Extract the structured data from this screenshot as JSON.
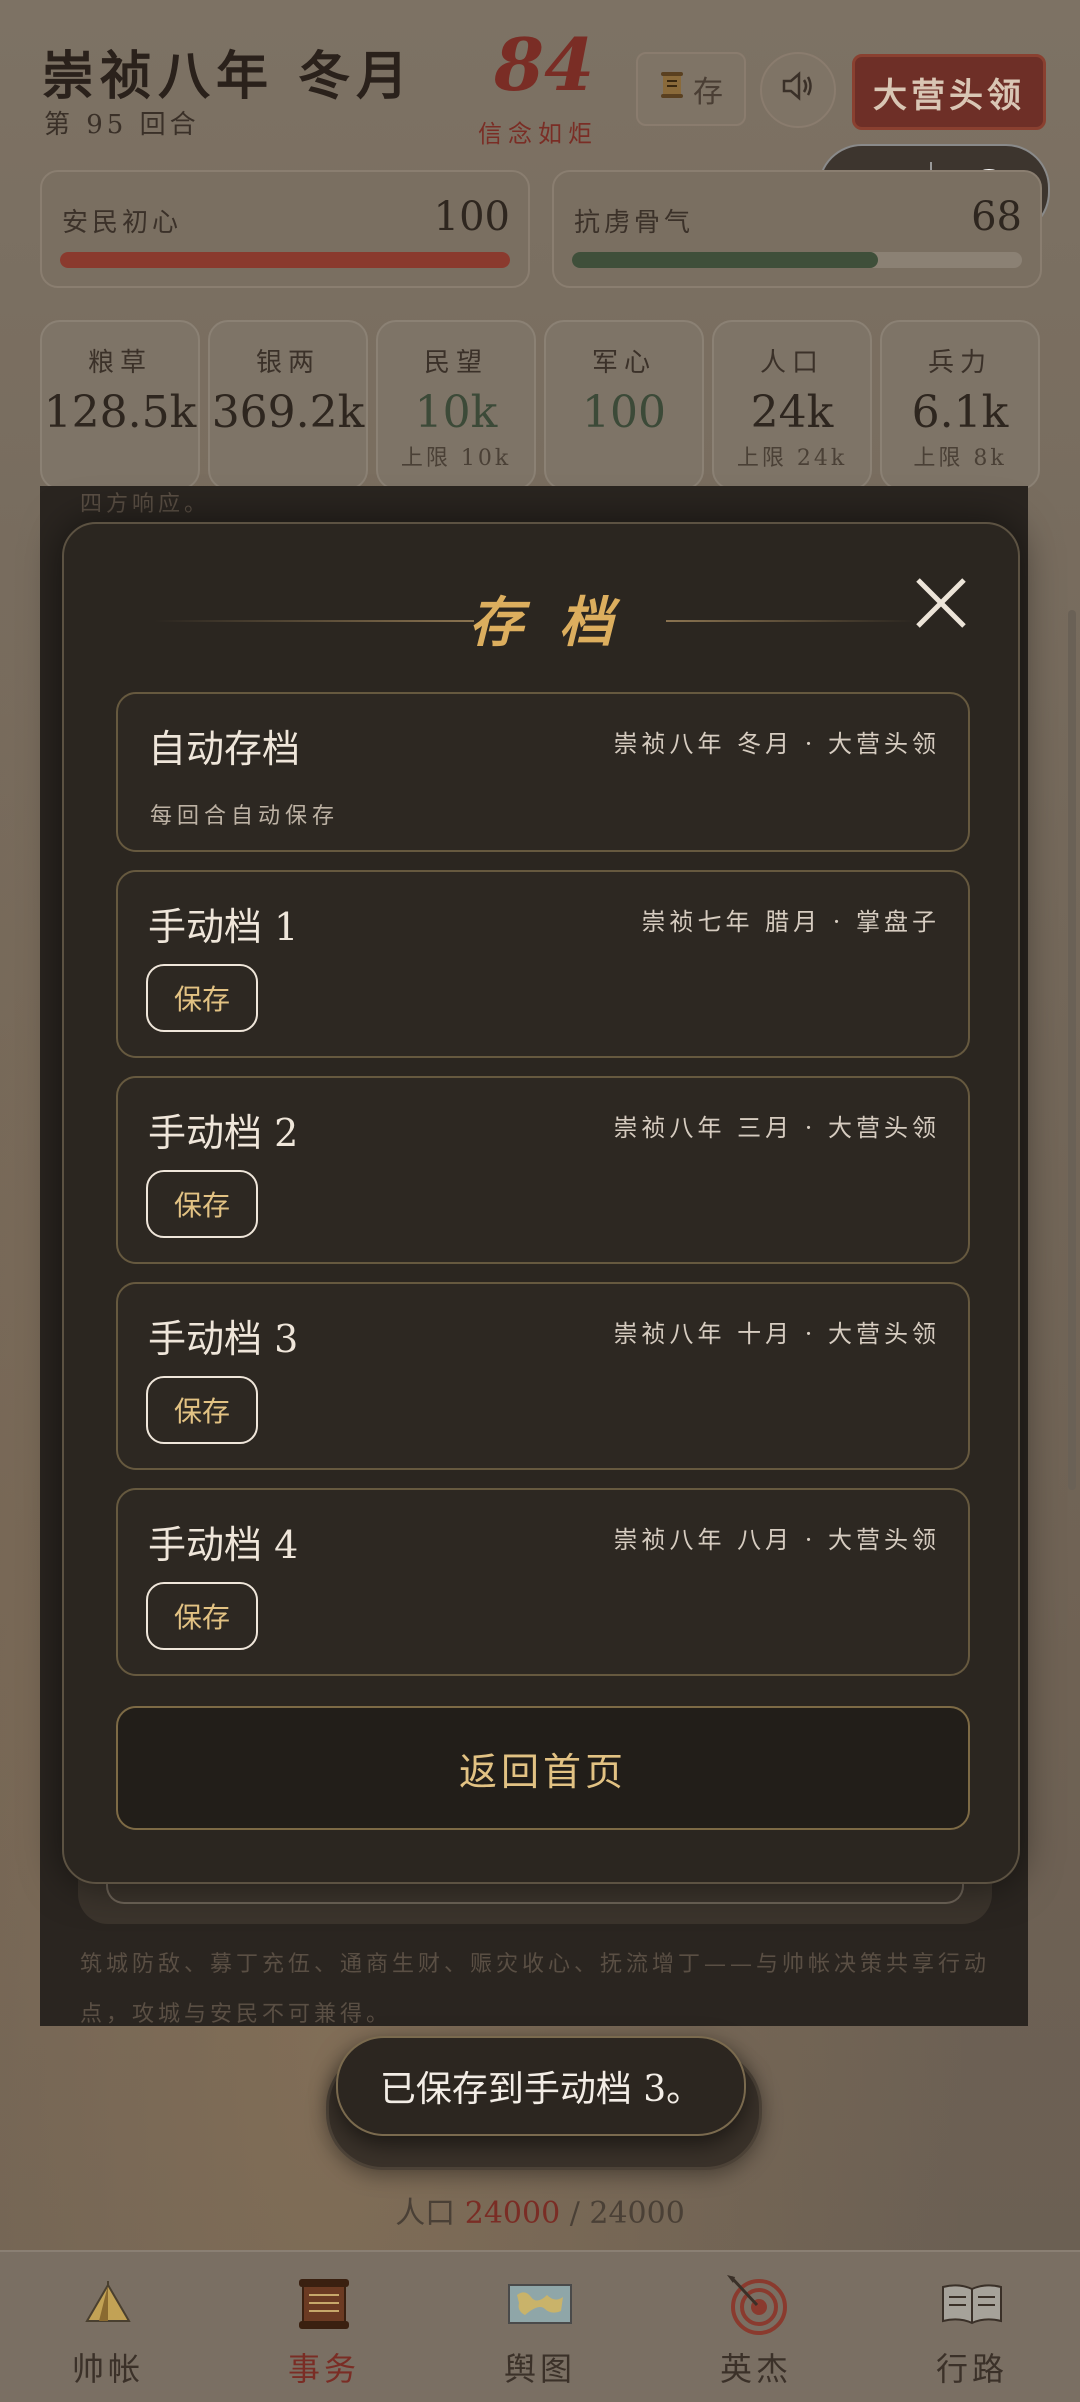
{
  "header": {
    "title": "崇祯八年 冬月",
    "turn": "第 95 回合",
    "belief_value": "84",
    "belief_label": "信念如炬",
    "save_label": "存",
    "rank_label": "大营头领"
  },
  "meters": [
    {
      "label": "安民初心",
      "value": "100",
      "fill": 1.0,
      "color": "#8a3a2e"
    },
    {
      "label": "抗虏骨气",
      "value": "68",
      "fill": 0.68,
      "color": "#3f4f3a"
    }
  ],
  "stats": [
    {
      "name": "粮草",
      "value": "128.5k",
      "cap": ""
    },
    {
      "name": "银两",
      "value": "369.2k",
      "cap": ""
    },
    {
      "name": "民望",
      "value": "10k",
      "cap": "上限 10k"
    },
    {
      "name": "军心",
      "value": "100",
      "cap": ""
    },
    {
      "name": "人口",
      "value": "24k",
      "cap": "上限 24k"
    },
    {
      "name": "兵力",
      "value": "6.1k",
      "cap": "上限 8k"
    }
  ],
  "background": {
    "event_top_text": "四方响应。",
    "event_bottom_text": "筑城防敌、募丁充伍、通商生财、赈灾收心、抚流增丁——与帅帐决策共享行动点，攻城与安民不可兼得。",
    "population_label": "人口",
    "population_current": "24000",
    "population_sep": " / ",
    "population_max": "24000"
  },
  "modal": {
    "title": "存档",
    "slots": [
      {
        "name": "自动存档",
        "meta": "崇祯八年 冬月 · 大营头领",
        "note": "每回合自动保存"
      },
      {
        "name": "手动档 1",
        "meta": "崇祯七年 腊月 · 掌盘子",
        "button": "保存"
      },
      {
        "name": "手动档 2",
        "meta": "崇祯八年 三月 · 大营头领",
        "button": "保存"
      },
      {
        "name": "手动档 3",
        "meta": "崇祯八年 十月 · 大营头领",
        "button": "保存"
      },
      {
        "name": "手动档 4",
        "meta": "崇祯八年 八月 · 大营头领",
        "button": "保存"
      }
    ],
    "home_button": "返回首页"
  },
  "toast": "已保存到手动档 3。",
  "tabs": [
    {
      "label": "帅帐",
      "icon": "tent-icon",
      "active": false
    },
    {
      "label": "事务",
      "icon": "scroll-icon",
      "active": true
    },
    {
      "label": "舆图",
      "icon": "map-icon",
      "active": false
    },
    {
      "label": "英杰",
      "icon": "target-icon",
      "active": false
    },
    {
      "label": "行路",
      "icon": "book-icon",
      "active": false
    }
  ]
}
